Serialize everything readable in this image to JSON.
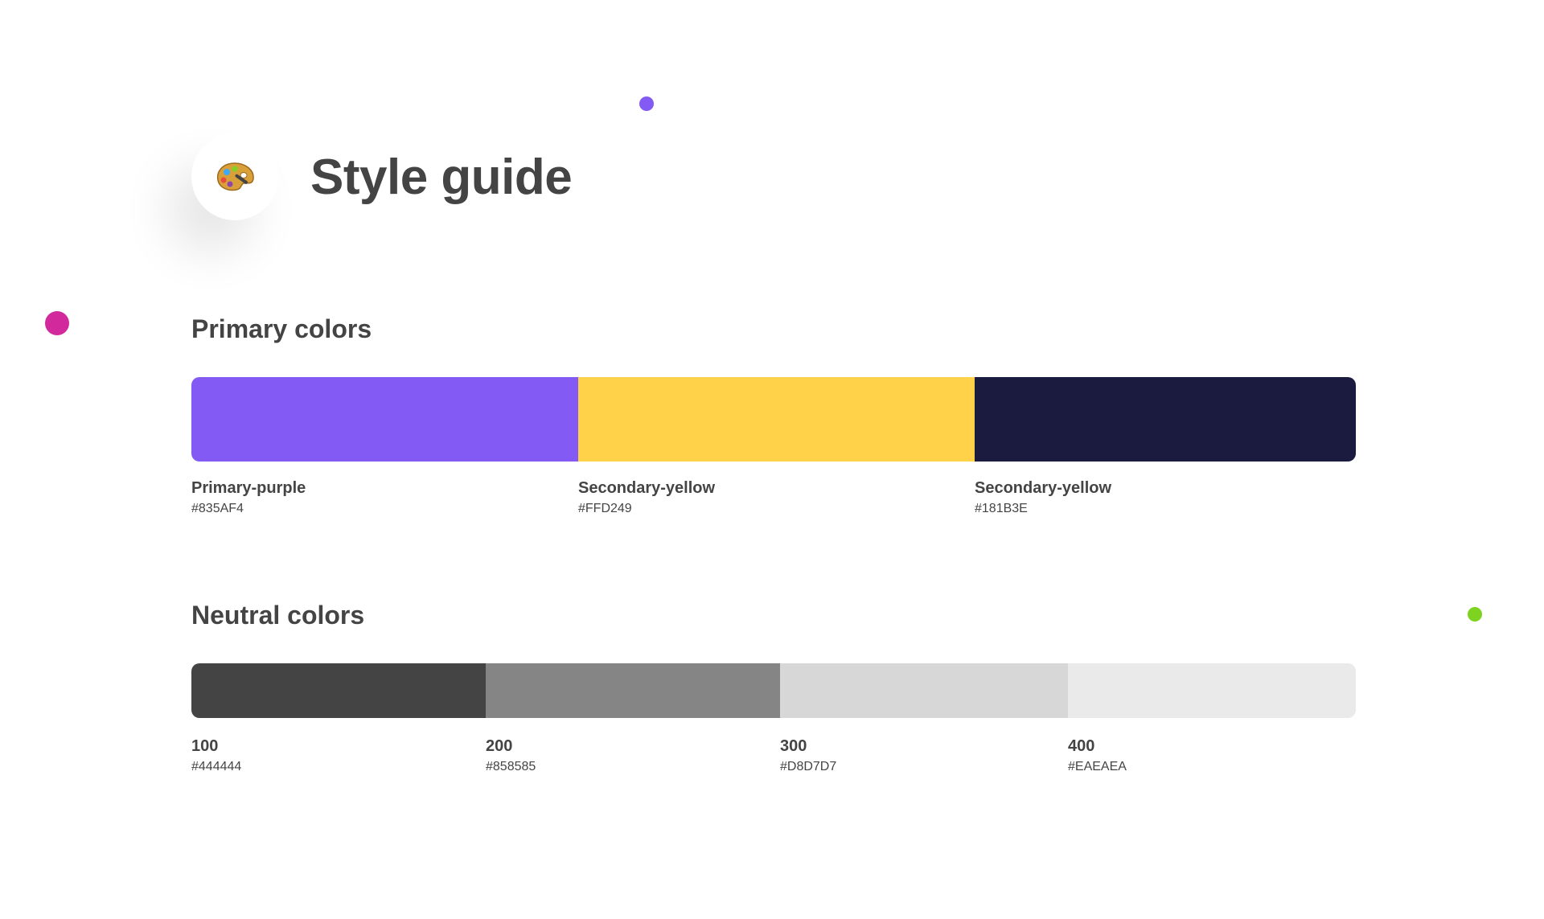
{
  "header": {
    "title": "Style guide",
    "icon": "artist-palette-icon"
  },
  "decor": {
    "dots": [
      {
        "color": "#835AF4"
      },
      {
        "color": "#D22A9C"
      },
      {
        "color": "#7ED321"
      }
    ]
  },
  "primary": {
    "title": "Primary colors",
    "swatches": [
      {
        "name": "Primary-purple",
        "hex": "#835AF4",
        "color": "#835AF4"
      },
      {
        "name": "Secondary-yellow",
        "hex": "#FFD249",
        "color": "#FFD249"
      },
      {
        "name": "Secondary-yellow",
        "hex": "#181B3E",
        "color": "#1A1B3E"
      }
    ]
  },
  "neutral": {
    "title": "Neutral colors",
    "swatches": [
      {
        "name": "100",
        "hex": "#444444",
        "color": "#444444"
      },
      {
        "name": "200",
        "hex": "#858585",
        "color": "#858585"
      },
      {
        "name": "300",
        "hex": "#D8D7D7",
        "color": "#D8D7D7"
      },
      {
        "name": "400",
        "hex": "#EAEAEA",
        "color": "#EAEAEA"
      }
    ]
  }
}
